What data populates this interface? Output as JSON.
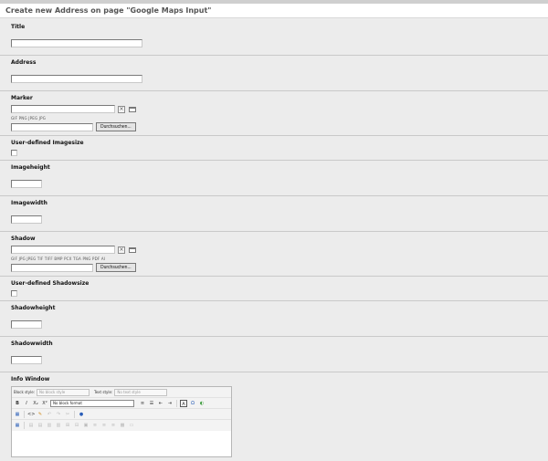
{
  "page_title": "Create new Address on page \"Google Maps Input\"",
  "fields": {
    "title": {
      "label": "Title",
      "value": ""
    },
    "address": {
      "label": "Address",
      "value": ""
    },
    "marker": {
      "label": "Marker",
      "value": "",
      "clear_glyph": "×",
      "file_types": "GIF PNG JPEG JPG",
      "browse_label": "Durchsuchen..."
    },
    "user_imagesize": {
      "label": "User-defined Imagesize",
      "checked": false
    },
    "imageheight": {
      "label": "Imageheight",
      "value": ""
    },
    "imagewidth": {
      "label": "Imagewidth",
      "value": ""
    },
    "shadow": {
      "label": "Shadow",
      "value": "",
      "clear_glyph": "×",
      "file_types": "GIF JPG JPEG TIF TIFF BMP PCX TGA PNG PDF AI",
      "browse_label": "Durchsuchen..."
    },
    "user_shadowsize": {
      "label": "User-defined Shadowsize",
      "checked": false
    },
    "shadowheight": {
      "label": "Shadowheight",
      "value": ""
    },
    "shadowwidth": {
      "label": "Shadowwidth",
      "value": ""
    },
    "info_window": {
      "label": "Info Window",
      "block_style_label": "Block style:",
      "block_style_value": "No block style",
      "text_style_label": "Text style:",
      "text_style_value": "No text style",
      "format_value": "No block format",
      "bold": "B",
      "italic": "I",
      "subscript": "X₂",
      "superscript": "X²",
      "source": "<>",
      "char_a": "A",
      "omega": "Ω"
    }
  },
  "colors": {
    "form_background": "#ececec",
    "title_text": "#555555",
    "link_blue": "#2a5eb8"
  }
}
